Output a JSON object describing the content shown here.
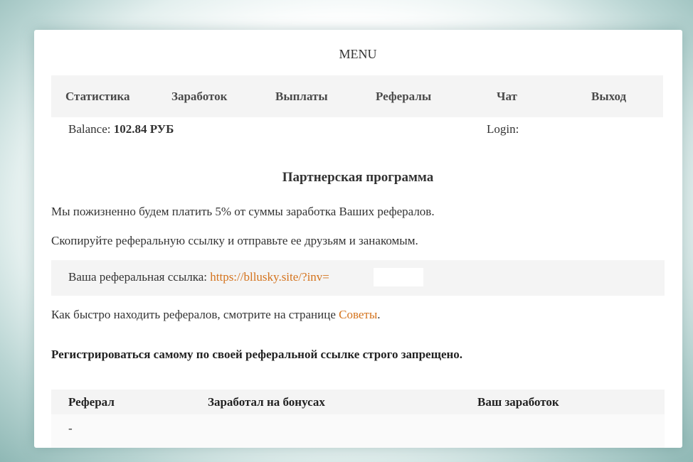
{
  "menu": {
    "title": "MENU",
    "items": [
      {
        "label": "Статистика"
      },
      {
        "label": "Заработок"
      },
      {
        "label": "Выплаты"
      },
      {
        "label": "Рефералы"
      },
      {
        "label": "Чат"
      },
      {
        "label": "Выход"
      }
    ]
  },
  "account": {
    "balance_label": "Balance:",
    "balance_value": "102.84 РУБ",
    "login_label": "Login:"
  },
  "page": {
    "title": "Партнерская программа",
    "line1": "Мы пожизненно будем платить 5% от суммы заработка Ваших рефералов.",
    "line2": "Скопируйте реферальную ссылку и отправьте ее друзьям и занакомым.",
    "ref_label": "Ваша реферальная ссылка:",
    "ref_url": "https://bllusky.site/?inv=",
    "tips_text": "Как быстро находить рефералов, смотрите на странице",
    "tips_link": "Советы",
    "tips_suffix": ".",
    "warning": "Регистрироваться самому по своей реферальной ссылке строго запрещено."
  },
  "table": {
    "headers": [
      "Реферал",
      "Заработал на бонусах",
      "Ваш заработок"
    ],
    "rows": [
      [
        "-"
      ]
    ]
  }
}
